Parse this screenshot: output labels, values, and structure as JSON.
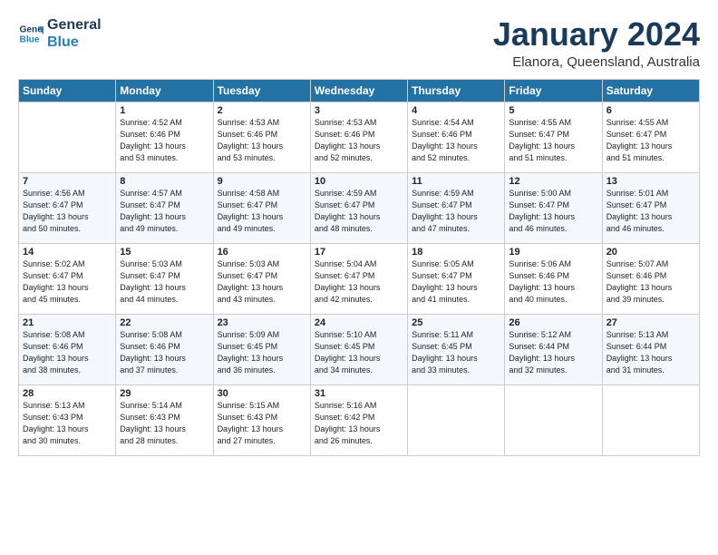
{
  "header": {
    "logo_line1": "General",
    "logo_line2": "Blue",
    "month_title": "January 2024",
    "location": "Elanora, Queensland, Australia"
  },
  "weekdays": [
    "Sunday",
    "Monday",
    "Tuesday",
    "Wednesday",
    "Thursday",
    "Friday",
    "Saturday"
  ],
  "weeks": [
    [
      {
        "day": "",
        "info": ""
      },
      {
        "day": "1",
        "info": "Sunrise: 4:52 AM\nSunset: 6:46 PM\nDaylight: 13 hours\nand 53 minutes."
      },
      {
        "day": "2",
        "info": "Sunrise: 4:53 AM\nSunset: 6:46 PM\nDaylight: 13 hours\nand 53 minutes."
      },
      {
        "day": "3",
        "info": "Sunrise: 4:53 AM\nSunset: 6:46 PM\nDaylight: 13 hours\nand 52 minutes."
      },
      {
        "day": "4",
        "info": "Sunrise: 4:54 AM\nSunset: 6:46 PM\nDaylight: 13 hours\nand 52 minutes."
      },
      {
        "day": "5",
        "info": "Sunrise: 4:55 AM\nSunset: 6:47 PM\nDaylight: 13 hours\nand 51 minutes."
      },
      {
        "day": "6",
        "info": "Sunrise: 4:55 AM\nSunset: 6:47 PM\nDaylight: 13 hours\nand 51 minutes."
      }
    ],
    [
      {
        "day": "7",
        "info": "Sunrise: 4:56 AM\nSunset: 6:47 PM\nDaylight: 13 hours\nand 50 minutes."
      },
      {
        "day": "8",
        "info": "Sunrise: 4:57 AM\nSunset: 6:47 PM\nDaylight: 13 hours\nand 49 minutes."
      },
      {
        "day": "9",
        "info": "Sunrise: 4:58 AM\nSunset: 6:47 PM\nDaylight: 13 hours\nand 49 minutes."
      },
      {
        "day": "10",
        "info": "Sunrise: 4:59 AM\nSunset: 6:47 PM\nDaylight: 13 hours\nand 48 minutes."
      },
      {
        "day": "11",
        "info": "Sunrise: 4:59 AM\nSunset: 6:47 PM\nDaylight: 13 hours\nand 47 minutes."
      },
      {
        "day": "12",
        "info": "Sunrise: 5:00 AM\nSunset: 6:47 PM\nDaylight: 13 hours\nand 46 minutes."
      },
      {
        "day": "13",
        "info": "Sunrise: 5:01 AM\nSunset: 6:47 PM\nDaylight: 13 hours\nand 46 minutes."
      }
    ],
    [
      {
        "day": "14",
        "info": "Sunrise: 5:02 AM\nSunset: 6:47 PM\nDaylight: 13 hours\nand 45 minutes."
      },
      {
        "day": "15",
        "info": "Sunrise: 5:03 AM\nSunset: 6:47 PM\nDaylight: 13 hours\nand 44 minutes."
      },
      {
        "day": "16",
        "info": "Sunrise: 5:03 AM\nSunset: 6:47 PM\nDaylight: 13 hours\nand 43 minutes."
      },
      {
        "day": "17",
        "info": "Sunrise: 5:04 AM\nSunset: 6:47 PM\nDaylight: 13 hours\nand 42 minutes."
      },
      {
        "day": "18",
        "info": "Sunrise: 5:05 AM\nSunset: 6:47 PM\nDaylight: 13 hours\nand 41 minutes."
      },
      {
        "day": "19",
        "info": "Sunrise: 5:06 AM\nSunset: 6:46 PM\nDaylight: 13 hours\nand 40 minutes."
      },
      {
        "day": "20",
        "info": "Sunrise: 5:07 AM\nSunset: 6:46 PM\nDaylight: 13 hours\nand 39 minutes."
      }
    ],
    [
      {
        "day": "21",
        "info": "Sunrise: 5:08 AM\nSunset: 6:46 PM\nDaylight: 13 hours\nand 38 minutes."
      },
      {
        "day": "22",
        "info": "Sunrise: 5:08 AM\nSunset: 6:46 PM\nDaylight: 13 hours\nand 37 minutes."
      },
      {
        "day": "23",
        "info": "Sunrise: 5:09 AM\nSunset: 6:45 PM\nDaylight: 13 hours\nand 36 minutes."
      },
      {
        "day": "24",
        "info": "Sunrise: 5:10 AM\nSunset: 6:45 PM\nDaylight: 13 hours\nand 34 minutes."
      },
      {
        "day": "25",
        "info": "Sunrise: 5:11 AM\nSunset: 6:45 PM\nDaylight: 13 hours\nand 33 minutes."
      },
      {
        "day": "26",
        "info": "Sunrise: 5:12 AM\nSunset: 6:44 PM\nDaylight: 13 hours\nand 32 minutes."
      },
      {
        "day": "27",
        "info": "Sunrise: 5:13 AM\nSunset: 6:44 PM\nDaylight: 13 hours\nand 31 minutes."
      }
    ],
    [
      {
        "day": "28",
        "info": "Sunrise: 5:13 AM\nSunset: 6:43 PM\nDaylight: 13 hours\nand 30 minutes."
      },
      {
        "day": "29",
        "info": "Sunrise: 5:14 AM\nSunset: 6:43 PM\nDaylight: 13 hours\nand 28 minutes."
      },
      {
        "day": "30",
        "info": "Sunrise: 5:15 AM\nSunset: 6:43 PM\nDaylight: 13 hours\nand 27 minutes."
      },
      {
        "day": "31",
        "info": "Sunrise: 5:16 AM\nSunset: 6:42 PM\nDaylight: 13 hours\nand 26 minutes."
      },
      {
        "day": "",
        "info": ""
      },
      {
        "day": "",
        "info": ""
      },
      {
        "day": "",
        "info": ""
      }
    ]
  ]
}
